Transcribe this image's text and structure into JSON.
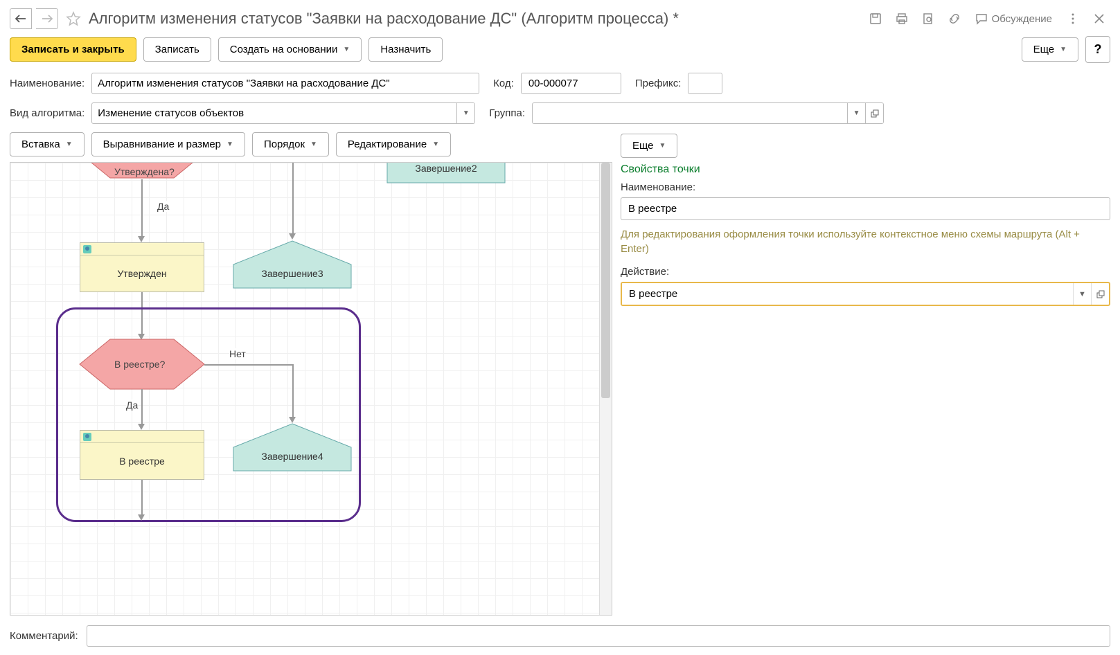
{
  "header": {
    "title": "Алгоритм изменения статусов \"Заявки на расходование ДС\" (Алгоритм процесса) *",
    "discuss": "Обсуждение"
  },
  "toolbar": {
    "save_close": "Записать и закрыть",
    "save": "Записать",
    "create_based": "Создать на основании",
    "assign": "Назначить",
    "more": "Еще",
    "help": "?"
  },
  "form": {
    "name_label": "Наименование:",
    "name_value": "Алгоритм изменения статусов \"Заявки на расходование ДС\"",
    "code_label": "Код:",
    "code_value": "00-000077",
    "prefix_label": "Префикс:",
    "prefix_value": "",
    "algo_label": "Вид алгоритма:",
    "algo_value": "Изменение статусов объектов",
    "group_label": "Группа:",
    "group_value": ""
  },
  "diag_toolbar": {
    "insert": "Вставка",
    "align": "Выравнивание и размер",
    "order": "Порядок",
    "edit": "Редактирование",
    "more": "Еще"
  },
  "diagram": {
    "decision1": "Утверждена?",
    "label_yes1": "Да",
    "task1": "Утвержден",
    "end2": "Завершение2",
    "end3": "Завершение3",
    "decision2": "В реестре?",
    "label_no": "Нет",
    "label_yes2": "Да",
    "task2": "В реестре",
    "end4": "Завершение4"
  },
  "props": {
    "title": "Свойства точки",
    "name_label": "Наименование:",
    "name_value": "В реестре",
    "hint": "Для редактирования оформления точки используйте контекстное меню схемы маршрута (Alt + Enter)",
    "action_label": "Действие:",
    "action_value": "В реестре"
  },
  "footer": {
    "comment_label": "Комментарий:",
    "comment_value": ""
  }
}
